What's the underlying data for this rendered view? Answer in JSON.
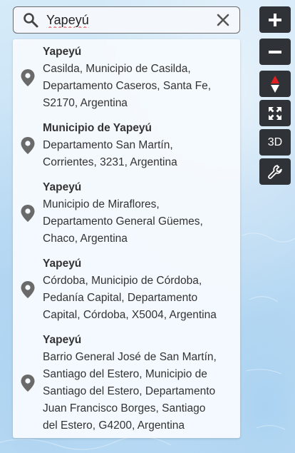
{
  "search": {
    "value": "Yapeyú",
    "icon": "search-icon",
    "clear_icon": "close-icon"
  },
  "results": [
    {
      "title": "Yapeyú",
      "lines": [
        "Casilda, Municipio de Casilda,",
        "Departamento Caseros, Santa Fe,",
        "S2170, Argentina"
      ]
    },
    {
      "title": "Municipio de Yapeyú",
      "lines": [
        "Departamento San Martín,",
        "Corrientes, 3231, Argentina"
      ]
    },
    {
      "title": "Yapeyú",
      "lines": [
        "Municipio de Miraflores,",
        "Departamento General Güemes,",
        "Chaco, Argentina"
      ]
    },
    {
      "title": "Yapeyú",
      "lines": [
        "Córdoba, Municipio de Córdoba,",
        "Pedanía Capital, Departamento",
        "Capital, Córdoba, X5004, Argentina"
      ]
    },
    {
      "title": "Yapeyú",
      "lines": [
        "Barrio General José de San Martín,",
        "Santiago del Estero, Municipio de",
        "Santiago del Estero, Departamento",
        "Juan Francisco Borges, Santiago",
        "del Estero, G4200, Argentina"
      ]
    }
  ],
  "controls": {
    "zoom_in_icon": "plus-icon",
    "zoom_out_icon": "minus-icon",
    "compass_icon": "compass-icon",
    "fullscreen_icon": "expand-icon",
    "mode_3d_label": "3D",
    "tools_icon": "wrench-icon"
  },
  "colors": {
    "control_bg": "#2f3236",
    "compass_north": "#e02020",
    "pin": "#6a6a6a"
  }
}
